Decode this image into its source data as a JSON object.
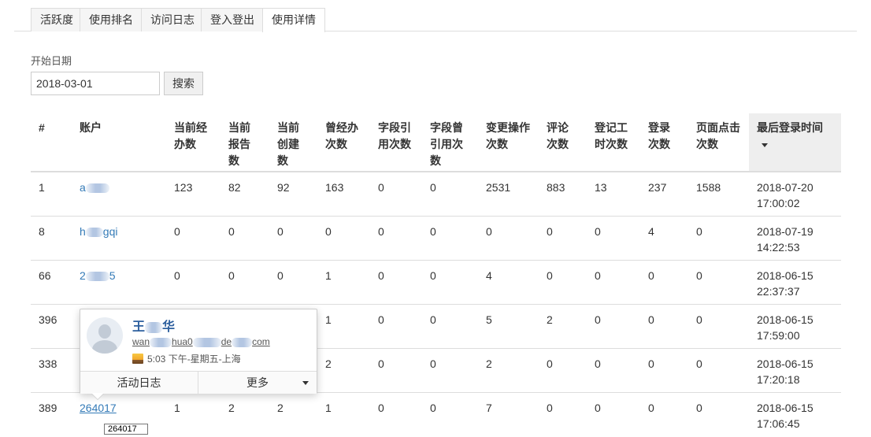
{
  "tabs": [
    {
      "label": "活跃度",
      "active": false
    },
    {
      "label": "使用排名",
      "active": false
    },
    {
      "label": "访问日志",
      "active": false
    },
    {
      "label": "登入登出",
      "active": false
    },
    {
      "label": "使用详情",
      "active": true
    }
  ],
  "filter": {
    "label": "开始日期",
    "date_value": "2018-03-01",
    "search_label": "搜索"
  },
  "table": {
    "headers": {
      "index": "#",
      "account": "账户",
      "current_handling": [
        "当前经",
        "办数"
      ],
      "current_reports": [
        "当前",
        "报告",
        "数"
      ],
      "current_created": [
        "当前",
        "创建",
        "数"
      ],
      "handled_total": [
        "曾经办",
        "次数"
      ],
      "field_refs": [
        "字段引",
        "用次数"
      ],
      "field_refs_past": [
        "字段曾",
        "引用次",
        "数"
      ],
      "change_ops": [
        "变更操作",
        "次数"
      ],
      "comments": [
        "评论",
        "次数"
      ],
      "time_logs": [
        "登记工",
        "时次数"
      ],
      "logins": [
        "登录",
        "次数"
      ],
      "page_clicks": [
        "页面点击",
        "次数"
      ],
      "last_login": "最后登录时间"
    },
    "rows": [
      {
        "index": "1",
        "account": [
          "a",
          ""
        ],
        "current_handling": "123",
        "current_reports": "82",
        "current_created": "92",
        "handled_total": "163",
        "field_refs": "0",
        "field_refs_past": "0",
        "change_ops": "2531",
        "comments": "883",
        "time_logs": "13",
        "logins": "237",
        "page_clicks": "1588",
        "last_login_date": "2018-07-20",
        "last_login_time": "17:00:02"
      },
      {
        "index": "8",
        "account": [
          "h",
          "gqi"
        ],
        "current_handling": "0",
        "current_reports": "0",
        "current_created": "0",
        "handled_total": "0",
        "field_refs": "0",
        "field_refs_past": "0",
        "change_ops": "0",
        "comments": "0",
        "time_logs": "0",
        "logins": "4",
        "page_clicks": "0",
        "last_login_date": "2018-07-19",
        "last_login_time": "14:22:53"
      },
      {
        "index": "66",
        "account": [
          "2",
          "5"
        ],
        "current_handling": "0",
        "current_reports": "0",
        "current_created": "0",
        "handled_total": "1",
        "field_refs": "0",
        "field_refs_past": "0",
        "change_ops": "4",
        "comments": "0",
        "time_logs": "0",
        "logins": "0",
        "page_clicks": "0",
        "last_login_date": "2018-06-15",
        "last_login_time": "22:37:37"
      },
      {
        "index": "396",
        "account": [
          "",
          ""
        ],
        "current_handling": "",
        "current_reports": "",
        "current_created": "",
        "handled_total": "1",
        "field_refs": "0",
        "field_refs_past": "0",
        "change_ops": "5",
        "comments": "2",
        "time_logs": "0",
        "logins": "0",
        "page_clicks": "0",
        "last_login_date": "2018-06-15",
        "last_login_time": "17:59:00"
      },
      {
        "index": "338",
        "account": [
          "",
          ""
        ],
        "current_handling": "",
        "current_reports": "",
        "current_created": "",
        "handled_total": "2",
        "field_refs": "0",
        "field_refs_past": "0",
        "change_ops": "2",
        "comments": "0",
        "time_logs": "0",
        "logins": "0",
        "page_clicks": "0",
        "last_login_date": "2018-06-15",
        "last_login_time": "17:20:18"
      },
      {
        "index": "389",
        "account": [
          "264017",
          ""
        ],
        "current_handling": "1",
        "current_reports": "2",
        "current_created": "2",
        "handled_total": "1",
        "field_refs": "0",
        "field_refs_past": "0",
        "change_ops": "7",
        "comments": "0",
        "time_logs": "0",
        "logins": "0",
        "page_clicks": "0",
        "last_login_date": "2018-06-15",
        "last_login_time": "17:06:45"
      }
    ]
  },
  "popover": {
    "name": "王",
    "name_tail": "华",
    "email_parts": [
      "wan",
      "hua0",
      "de",
      "com"
    ],
    "local_time": "5:03 下午-星期五-上海",
    "activity_log_label": "活动日志",
    "more_label": "更多"
  },
  "tooltip": {
    "text": "264017"
  },
  "colors": {
    "link": "#337ab7",
    "border": "#dddddd",
    "sorted_header_bg": "#eeeeee",
    "popover_name": "#2d5f9e"
  }
}
